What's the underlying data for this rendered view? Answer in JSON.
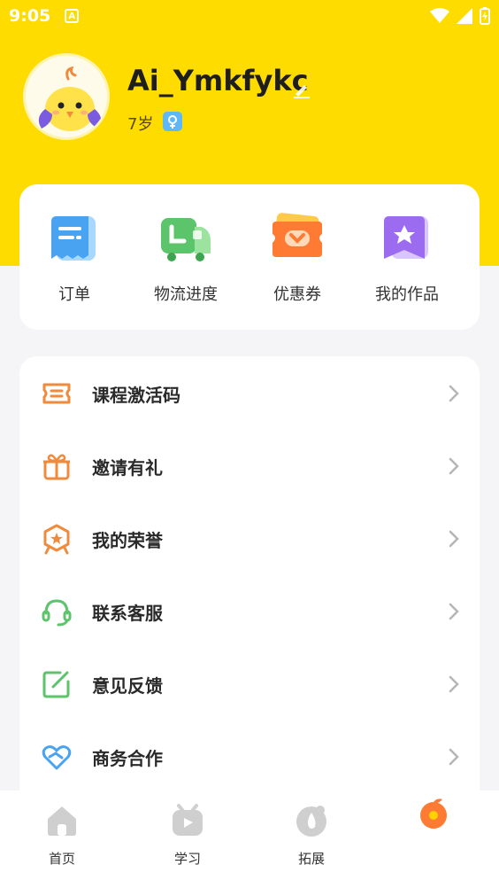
{
  "status_bar": {
    "time": "9:05",
    "app_badge": "A"
  },
  "profile": {
    "username": "Ai_Ymkfykc",
    "age": "7岁"
  },
  "quick_actions": [
    {
      "label": "订单",
      "icon": "order-icon"
    },
    {
      "label": "物流进度",
      "icon": "delivery-truck-icon"
    },
    {
      "label": "优惠券",
      "icon": "coupon-icon"
    },
    {
      "label": "我的作品",
      "icon": "star-works-icon"
    }
  ],
  "menu": [
    {
      "label": "课程激活码",
      "icon": "ticket-icon"
    },
    {
      "label": "邀请有礼",
      "icon": "gift-icon"
    },
    {
      "label": "我的荣誉",
      "icon": "badge-icon"
    },
    {
      "label": "联系客服",
      "icon": "headset-icon"
    },
    {
      "label": "意见反馈",
      "icon": "feedback-icon"
    },
    {
      "label": "商务合作",
      "icon": "handshake-heart-icon"
    }
  ],
  "tabs": [
    {
      "label": "首页",
      "icon": "home-icon"
    },
    {
      "label": "学习",
      "icon": "tv-icon"
    },
    {
      "label": "拓展",
      "icon": "explore-icon"
    },
    {
      "label": "",
      "icon": "orange-fruit-icon"
    }
  ],
  "colors": {
    "brand_yellow": "#FFDC00",
    "accent_orange": "#F08A3C",
    "accent_green": "#5CC46A"
  }
}
